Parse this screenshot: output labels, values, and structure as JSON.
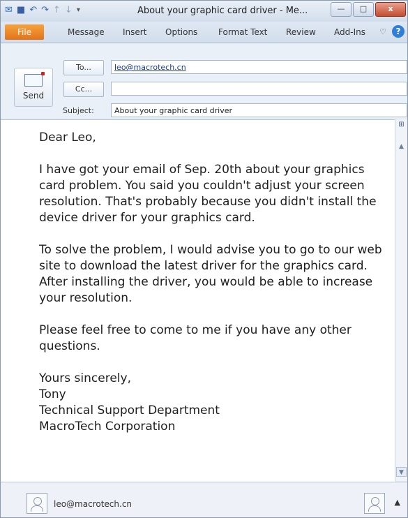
{
  "window": {
    "title": "About your graphic card driver - Me...",
    "minimize": "—",
    "restore": "□",
    "close": "x"
  },
  "ribbon": {
    "tabs": [
      "File",
      "Message",
      "Insert",
      "Options",
      "Format Text",
      "Review",
      "Add-Ins"
    ],
    "help": "?"
  },
  "compose": {
    "send_label": "Send",
    "to_button": "To...",
    "cc_button": "Cc...",
    "subject_label": "Subject:",
    "to_value": "leo@macrotech.cn",
    "cc_value": "",
    "subject_value": "About your graphic card driver"
  },
  "body": {
    "greeting": "Dear Leo,",
    "paragraph1": "I have got your email of Sep. 20th about your graphics card problem. You said you couldn't adjust your screen resolution. That's probably because you didn't install the device driver for your graphics card.",
    "paragraph2": "To solve the problem, I would advise you to go to our web site to download the latest driver for the graphics card. After installing the driver, you would be able to increase your resolution.",
    "paragraph3": "Please feel free to come to me if you have any other questions.",
    "closing": "Yours sincerely,\nTony\nTechnical Support Department\nMacroTech Corporation"
  },
  "people_pane": {
    "email": "leo@macrotech.cn"
  }
}
